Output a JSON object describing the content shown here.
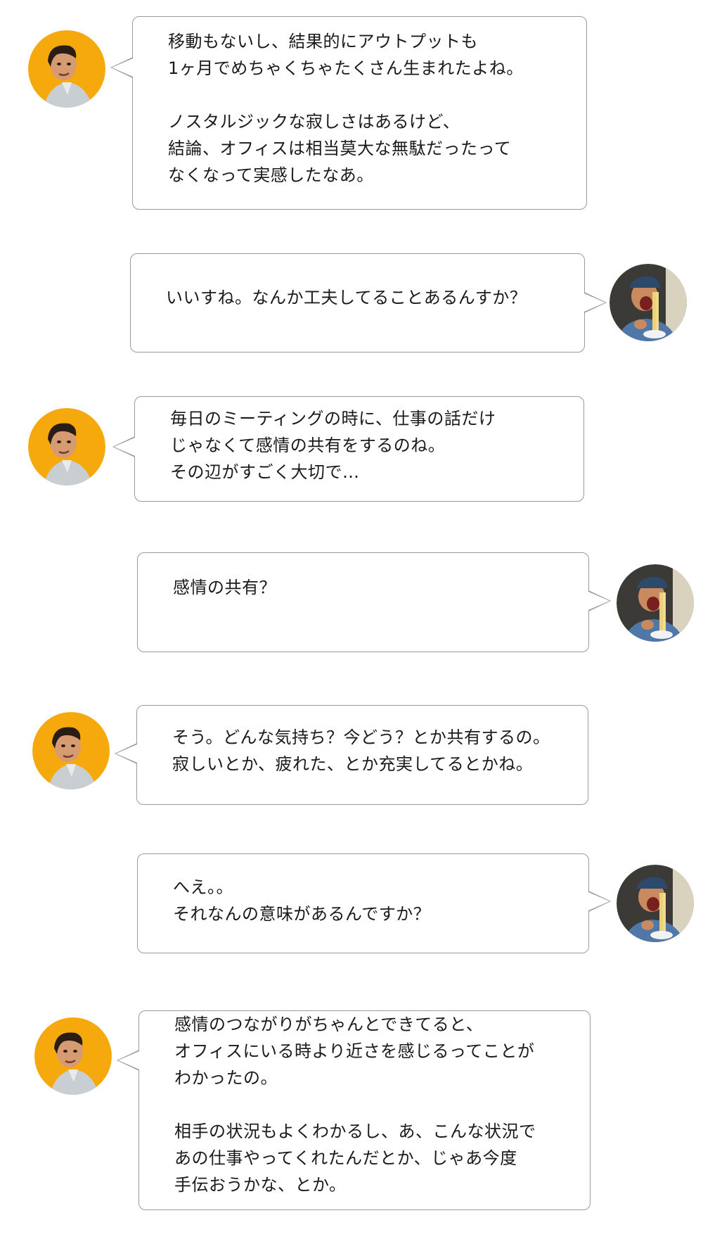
{
  "colors": {
    "bubble_border": "#9a9a9a",
    "avatar_a_background": "#f6a90c",
    "avatar_b_background": "#3b3a36"
  },
  "messages": [
    {
      "speaker": "A",
      "avatar_icon": "man-orange-avatar-icon",
      "lines": [
        "移動もないし、結果的にアウトプットも",
        "1ヶ月でめちゃくちゃたくさん生まれたよね。",
        "",
        "ノスタルジックな寂しさはあるけど、",
        "結論、オフィスは相当莫大な無駄だったって",
        "なくなって実感したなあ。"
      ]
    },
    {
      "speaker": "B",
      "avatar_icon": "man-eating-noodles-avatar-icon",
      "lines": [
        "いいすね。なんか工夫してることあるんすか？"
      ]
    },
    {
      "speaker": "A",
      "avatar_icon": "man-orange-avatar-icon",
      "lines": [
        "毎日のミーティングの時に、仕事の話だけ",
        "じゃなくて感情の共有をするのね。",
        "その辺がすごく大切で…"
      ]
    },
    {
      "speaker": "B",
      "avatar_icon": "man-eating-noodles-avatar-icon",
      "lines": [
        "感情の共有？"
      ]
    },
    {
      "speaker": "A",
      "avatar_icon": "man-orange-avatar-icon",
      "lines": [
        "そう。どんな気持ち？今どう？とか共有するの。",
        "寂しいとか、疲れた、とか充実してるとかね。"
      ]
    },
    {
      "speaker": "B",
      "avatar_icon": "man-eating-noodles-avatar-icon",
      "lines": [
        "へえ。。",
        "それなんの意味があるんですか？"
      ]
    },
    {
      "speaker": "A",
      "avatar_icon": "man-orange-avatar-icon",
      "lines": [
        "感情のつながりがちゃんとできてると、",
        "オフィスにいる時より近さを感じるってことが",
        "わかったの。",
        "",
        "相手の状況もよくわかるし、あ、こんな状況で",
        "あの仕事やってくれたんだとか、じゃあ今度",
        "手伝おうかな、とか。"
      ]
    }
  ]
}
